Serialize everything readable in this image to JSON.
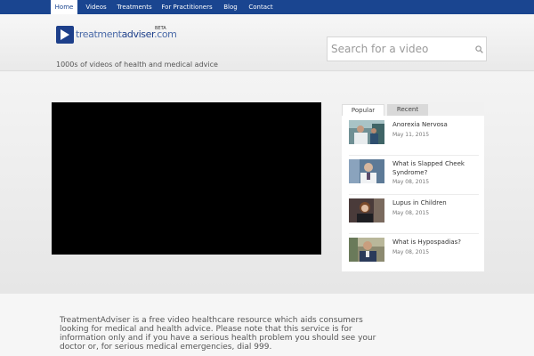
{
  "nav": {
    "items": [
      {
        "label": "Home",
        "active": true
      },
      {
        "label": "Videos",
        "active": false
      },
      {
        "label": "Treatments",
        "active": false
      },
      {
        "label": "For Practitioners",
        "active": false
      },
      {
        "label": "Blog",
        "active": false
      },
      {
        "label": "Contact",
        "active": false
      }
    ]
  },
  "header": {
    "logo_part1": "treatment",
    "logo_part2": "adviser",
    "logo_part3": ".com",
    "logo_badge": "BETA",
    "tagline": "1000s of videos of health and medical advice"
  },
  "search": {
    "placeholder": "Search for a video",
    "icon": "search-icon"
  },
  "sidebar": {
    "tabs": [
      {
        "label": "Popular",
        "active": true
      },
      {
        "label": "Recent",
        "active": false
      }
    ],
    "videos": [
      {
        "title": "Anorexia Nervosa",
        "date": "May 11, 2015"
      },
      {
        "title": "What is Slapped Cheek Syndrome?",
        "date": "May 08, 2015"
      },
      {
        "title": "Lupus in Children",
        "date": "May 08, 2015"
      },
      {
        "title": "What is Hypospadias?",
        "date": "May 08, 2015"
      }
    ]
  },
  "footer": {
    "text": "TreatmentAdviser is a free video healthcare resource which aids consumers looking for medical and health advice. Please note that this service is for information only and if you have a serious health problem you should see your doctor or, for serious medical emergencies, dial 999."
  },
  "colors": {
    "nav_bg": "#1a4590",
    "brand": "#1d3f8a",
    "video_bg": "#000000"
  }
}
